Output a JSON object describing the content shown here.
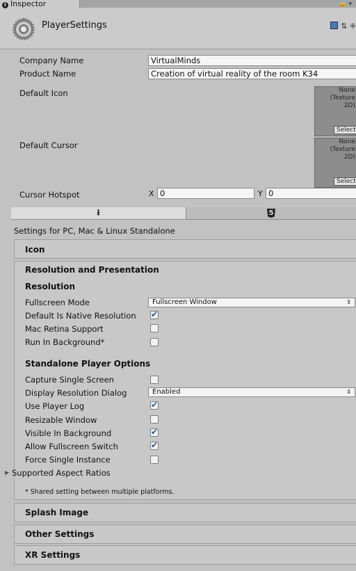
{
  "tab": {
    "label": "Inspector",
    "lock": "🔒 ▾"
  },
  "header": {
    "title": "PlayerSettings",
    "icons": "⇅ ⁜"
  },
  "company": {
    "label": "Company Name",
    "value": "VirtualMinds"
  },
  "product": {
    "label": "Product Name",
    "value": "Creation of virtual reality of the room K34"
  },
  "default_icon": {
    "label": "Default Icon",
    "box": [
      "None",
      "(Texture",
      "2D)"
    ],
    "select": "Select"
  },
  "default_cursor": {
    "label": "Default Cursor",
    "box": [
      "None",
      "(Texture",
      "2D)"
    ],
    "select": "Select"
  },
  "hotspot": {
    "label": "Cursor Hotspot",
    "x_label": "X",
    "x_value": "0",
    "y_label": "Y",
    "y_value": "0"
  },
  "platforms": {
    "standalone_icon": "download-icon",
    "web_icon": "html5-icon"
  },
  "settings_for": "Settings for PC, Mac & Linux Standalone",
  "sections": {
    "icon": "Icon",
    "resolution_presentation": "Resolution and Presentation",
    "splash": "Splash Image",
    "other": "Other Settings",
    "xr": "XR Settings"
  },
  "resolution": {
    "title": "Resolution",
    "fullscreen_mode": {
      "label": "Fullscreen Mode",
      "value": "Fullscreen Window"
    },
    "native_resolution": {
      "label": "Default Is Native Resolution",
      "checked": true
    },
    "mac_retina": {
      "label": "Mac Retina Support",
      "checked": false
    },
    "run_background": {
      "label": "Run In Background*",
      "checked": false
    }
  },
  "standalone": {
    "title": "Standalone Player Options",
    "capture_single": {
      "label": "Capture Single Screen",
      "checked": false
    },
    "display_dialog": {
      "label": "Display Resolution Dialog",
      "value": "Enabled"
    },
    "player_log": {
      "label": "Use Player Log",
      "checked": true
    },
    "resizable": {
      "label": "Resizable Window",
      "checked": false
    },
    "visible_bg": {
      "label": "Visible In Background",
      "checked": true
    },
    "allow_switch": {
      "label": "Allow Fullscreen Switch",
      "checked": true
    },
    "single_instance": {
      "label": "Force Single Instance",
      "checked": false
    }
  },
  "aspect_ratios": "Supported Aspect Ratios",
  "note": "* Shared setting between multiple platforms."
}
